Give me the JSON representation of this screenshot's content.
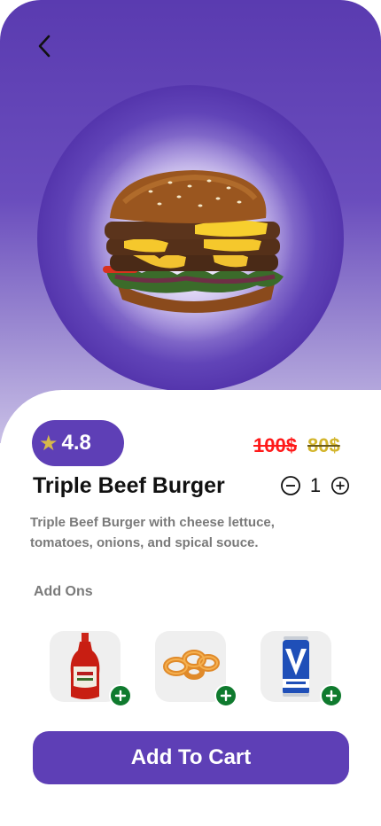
{
  "product": {
    "rating": "4.8",
    "old_price": "100$",
    "new_price": "80$",
    "title": "Triple Beef Burger",
    "quantity": "1",
    "description": "Triple Beef Burger with cheese lettuce, tomatoes, onions, and spical souce."
  },
  "addons": {
    "label": "Add Ons",
    "items": [
      {
        "icon": "ketchup-bottle-icon"
      },
      {
        "icon": "onion-rings-icon"
      },
      {
        "icon": "energy-drink-can-icon"
      }
    ]
  },
  "actions": {
    "add_to_cart_label": "Add To Cart"
  },
  "colors": {
    "brand_purple": "#5e3fb6",
    "old_price_red": "#ff1a1a",
    "new_price_gold": "#d3b52c",
    "add_green": "#0f7a2e"
  }
}
